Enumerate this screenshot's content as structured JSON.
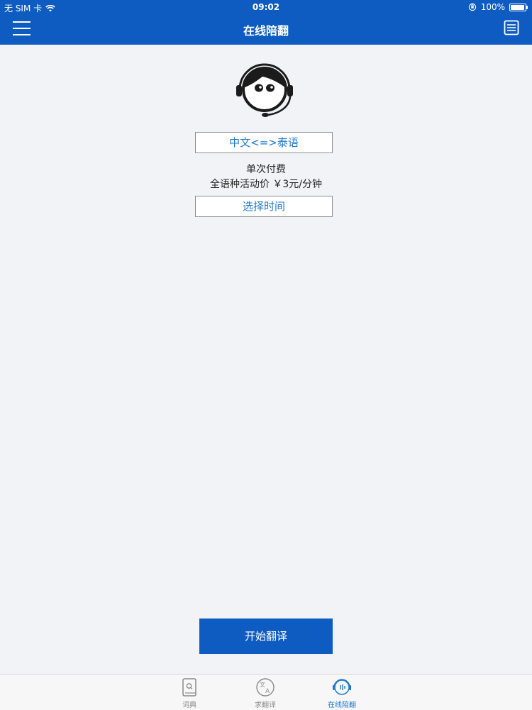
{
  "status_bar": {
    "carrier": "无 SIM 卡",
    "time": "09:02",
    "battery": "100%"
  },
  "header": {
    "title": "在线陪翻"
  },
  "main": {
    "language_pair": "中文<=>泰语",
    "payment_type": "单次付费",
    "price_line": "全语种活动价 ￥3元/分钟",
    "select_time_label": "选择时间",
    "start_label": "开始翻译"
  },
  "tabbar": {
    "items": [
      {
        "label": "词典",
        "icon": "dictionary-icon"
      },
      {
        "label": "求翻译",
        "icon": "translate-icon"
      },
      {
        "label": "在线陪翻",
        "icon": "online-interpreter-icon"
      }
    ],
    "active_index": 2
  },
  "colors": {
    "primary": "#0e5cc2",
    "accent_text": "#1f78d1",
    "background": "#f2f3f6",
    "inactive_tab": "#8a8a8a"
  }
}
